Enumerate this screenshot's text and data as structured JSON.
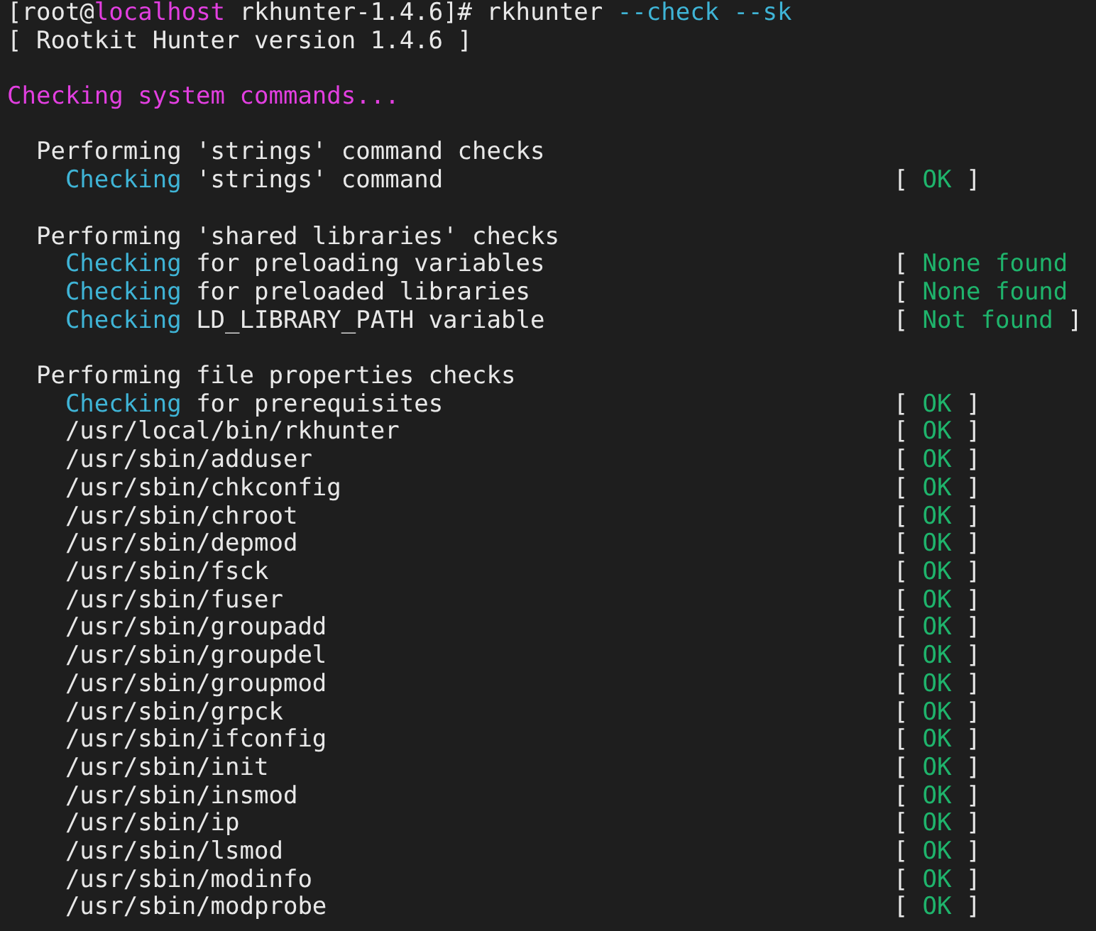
{
  "terminal": {
    "lines": [
      {
        "segments": [
          {
            "text": "[root@",
            "kind": "plain"
          },
          {
            "text": "localhost",
            "kind": "magenta"
          },
          {
            "text": " rkhunter-1.4.6]# rkhunter ",
            "kind": "plain"
          },
          {
            "text": "--check --sk",
            "kind": "cyan"
          }
        ]
      },
      {
        "segments": [
          {
            "text": "[ Rootkit Hunter version 1.4.6 ]",
            "kind": "plain"
          }
        ]
      }
    ],
    "sections": [
      {
        "heading": "Checking system commands...",
        "groups": [
          {
            "title": "Performing 'strings' command checks",
            "rows": [
              {
                "segments": [
                  {
                    "text": "Checking",
                    "kind": "cyan"
                  },
                  {
                    "text": " 'strings' command",
                    "kind": "plain"
                  }
                ],
                "status": [
                  {
                    "text": "[ ",
                    "kind": "plain"
                  },
                  {
                    "text": "OK",
                    "kind": "green"
                  },
                  {
                    "text": " ]",
                    "kind": "plain"
                  }
                ]
              }
            ]
          },
          {
            "title": "Performing 'shared libraries' checks",
            "rows": [
              {
                "segments": [
                  {
                    "text": "Checking",
                    "kind": "cyan"
                  },
                  {
                    "text": " for preloading variables",
                    "kind": "plain"
                  }
                ],
                "status": [
                  {
                    "text": "[ ",
                    "kind": "plain"
                  },
                  {
                    "text": "None found",
                    "kind": "green"
                  }
                ]
              },
              {
                "segments": [
                  {
                    "text": "Checking",
                    "kind": "cyan"
                  },
                  {
                    "text": " for preloaded libraries",
                    "kind": "plain"
                  }
                ],
                "status": [
                  {
                    "text": "[ ",
                    "kind": "plain"
                  },
                  {
                    "text": "None found",
                    "kind": "green"
                  }
                ]
              },
              {
                "segments": [
                  {
                    "text": "Checking",
                    "kind": "cyan"
                  },
                  {
                    "text": " LD_LIBRARY_PATH variable",
                    "kind": "plain"
                  }
                ],
                "status": [
                  {
                    "text": "[ ",
                    "kind": "plain"
                  },
                  {
                    "text": "Not found",
                    "kind": "green"
                  },
                  {
                    "text": " ]",
                    "kind": "plain"
                  }
                ]
              }
            ]
          },
          {
            "title": "Performing file properties checks",
            "rows": [
              {
                "segments": [
                  {
                    "text": "Checking",
                    "kind": "cyan"
                  },
                  {
                    "text": " for prerequisites",
                    "kind": "plain"
                  }
                ],
                "status": [
                  {
                    "text": "[ ",
                    "kind": "plain"
                  },
                  {
                    "text": "OK",
                    "kind": "green"
                  },
                  {
                    "text": " ]",
                    "kind": "plain"
                  }
                ]
              },
              {
                "segments": [
                  {
                    "text": "/usr/local/bin/rkhunter",
                    "kind": "plain"
                  }
                ],
                "status": [
                  {
                    "text": "[ ",
                    "kind": "plain"
                  },
                  {
                    "text": "OK",
                    "kind": "green"
                  },
                  {
                    "text": " ]",
                    "kind": "plain"
                  }
                ]
              },
              {
                "segments": [
                  {
                    "text": "/usr/sbin/adduser",
                    "kind": "plain"
                  }
                ],
                "status": [
                  {
                    "text": "[ ",
                    "kind": "plain"
                  },
                  {
                    "text": "OK",
                    "kind": "green"
                  },
                  {
                    "text": " ]",
                    "kind": "plain"
                  }
                ]
              },
              {
                "segments": [
                  {
                    "text": "/usr/sbin/chkconfig",
                    "kind": "plain"
                  }
                ],
                "status": [
                  {
                    "text": "[ ",
                    "kind": "plain"
                  },
                  {
                    "text": "OK",
                    "kind": "green"
                  },
                  {
                    "text": " ]",
                    "kind": "plain"
                  }
                ]
              },
              {
                "segments": [
                  {
                    "text": "/usr/sbin/chroot",
                    "kind": "plain"
                  }
                ],
                "status": [
                  {
                    "text": "[ ",
                    "kind": "plain"
                  },
                  {
                    "text": "OK",
                    "kind": "green"
                  },
                  {
                    "text": " ]",
                    "kind": "plain"
                  }
                ]
              },
              {
                "segments": [
                  {
                    "text": "/usr/sbin/depmod",
                    "kind": "plain"
                  }
                ],
                "status": [
                  {
                    "text": "[ ",
                    "kind": "plain"
                  },
                  {
                    "text": "OK",
                    "kind": "green"
                  },
                  {
                    "text": " ]",
                    "kind": "plain"
                  }
                ]
              },
              {
                "segments": [
                  {
                    "text": "/usr/sbin/fsck",
                    "kind": "plain"
                  }
                ],
                "status": [
                  {
                    "text": "[ ",
                    "kind": "plain"
                  },
                  {
                    "text": "OK",
                    "kind": "green"
                  },
                  {
                    "text": " ]",
                    "kind": "plain"
                  }
                ]
              },
              {
                "segments": [
                  {
                    "text": "/usr/sbin/fuser",
                    "kind": "plain"
                  }
                ],
                "status": [
                  {
                    "text": "[ ",
                    "kind": "plain"
                  },
                  {
                    "text": "OK",
                    "kind": "green"
                  },
                  {
                    "text": " ]",
                    "kind": "plain"
                  }
                ]
              },
              {
                "segments": [
                  {
                    "text": "/usr/sbin/groupadd",
                    "kind": "plain"
                  }
                ],
                "status": [
                  {
                    "text": "[ ",
                    "kind": "plain"
                  },
                  {
                    "text": "OK",
                    "kind": "green"
                  },
                  {
                    "text": " ]",
                    "kind": "plain"
                  }
                ]
              },
              {
                "segments": [
                  {
                    "text": "/usr/sbin/groupdel",
                    "kind": "plain"
                  }
                ],
                "status": [
                  {
                    "text": "[ ",
                    "kind": "plain"
                  },
                  {
                    "text": "OK",
                    "kind": "green"
                  },
                  {
                    "text": " ]",
                    "kind": "plain"
                  }
                ]
              },
              {
                "segments": [
                  {
                    "text": "/usr/sbin/groupmod",
                    "kind": "plain"
                  }
                ],
                "status": [
                  {
                    "text": "[ ",
                    "kind": "plain"
                  },
                  {
                    "text": "OK",
                    "kind": "green"
                  },
                  {
                    "text": " ]",
                    "kind": "plain"
                  }
                ]
              },
              {
                "segments": [
                  {
                    "text": "/usr/sbin/grpck",
                    "kind": "plain"
                  }
                ],
                "status": [
                  {
                    "text": "[ ",
                    "kind": "plain"
                  },
                  {
                    "text": "OK",
                    "kind": "green"
                  },
                  {
                    "text": " ]",
                    "kind": "plain"
                  }
                ]
              },
              {
                "segments": [
                  {
                    "text": "/usr/sbin/ifconfig",
                    "kind": "plain"
                  }
                ],
                "status": [
                  {
                    "text": "[ ",
                    "kind": "plain"
                  },
                  {
                    "text": "OK",
                    "kind": "green"
                  },
                  {
                    "text": " ]",
                    "kind": "plain"
                  }
                ]
              },
              {
                "segments": [
                  {
                    "text": "/usr/sbin/init",
                    "kind": "plain"
                  }
                ],
                "status": [
                  {
                    "text": "[ ",
                    "kind": "plain"
                  },
                  {
                    "text": "OK",
                    "kind": "green"
                  },
                  {
                    "text": " ]",
                    "kind": "plain"
                  }
                ]
              },
              {
                "segments": [
                  {
                    "text": "/usr/sbin/insmod",
                    "kind": "plain"
                  }
                ],
                "status": [
                  {
                    "text": "[ ",
                    "kind": "plain"
                  },
                  {
                    "text": "OK",
                    "kind": "green"
                  },
                  {
                    "text": " ]",
                    "kind": "plain"
                  }
                ]
              },
              {
                "segments": [
                  {
                    "text": "/usr/sbin/ip",
                    "kind": "plain"
                  }
                ],
                "status": [
                  {
                    "text": "[ ",
                    "kind": "plain"
                  },
                  {
                    "text": "OK",
                    "kind": "green"
                  },
                  {
                    "text": " ]",
                    "kind": "plain"
                  }
                ]
              },
              {
                "segments": [
                  {
                    "text": "/usr/sbin/lsmod",
                    "kind": "plain"
                  }
                ],
                "status": [
                  {
                    "text": "[ ",
                    "kind": "plain"
                  },
                  {
                    "text": "OK",
                    "kind": "green"
                  },
                  {
                    "text": " ]",
                    "kind": "plain"
                  }
                ]
              },
              {
                "segments": [
                  {
                    "text": "/usr/sbin/modinfo",
                    "kind": "plain"
                  }
                ],
                "status": [
                  {
                    "text": "[ ",
                    "kind": "plain"
                  },
                  {
                    "text": "OK",
                    "kind": "green"
                  },
                  {
                    "text": " ]",
                    "kind": "plain"
                  }
                ]
              },
              {
                "segments": [
                  {
                    "text": "/usr/sbin/modprobe",
                    "kind": "plain"
                  }
                ],
                "status": [
                  {
                    "text": "[ ",
                    "kind": "plain"
                  },
                  {
                    "text": "OK",
                    "kind": "green"
                  },
                  {
                    "text": " ]",
                    "kind": "plain"
                  }
                ]
              }
            ]
          }
        ]
      }
    ]
  }
}
